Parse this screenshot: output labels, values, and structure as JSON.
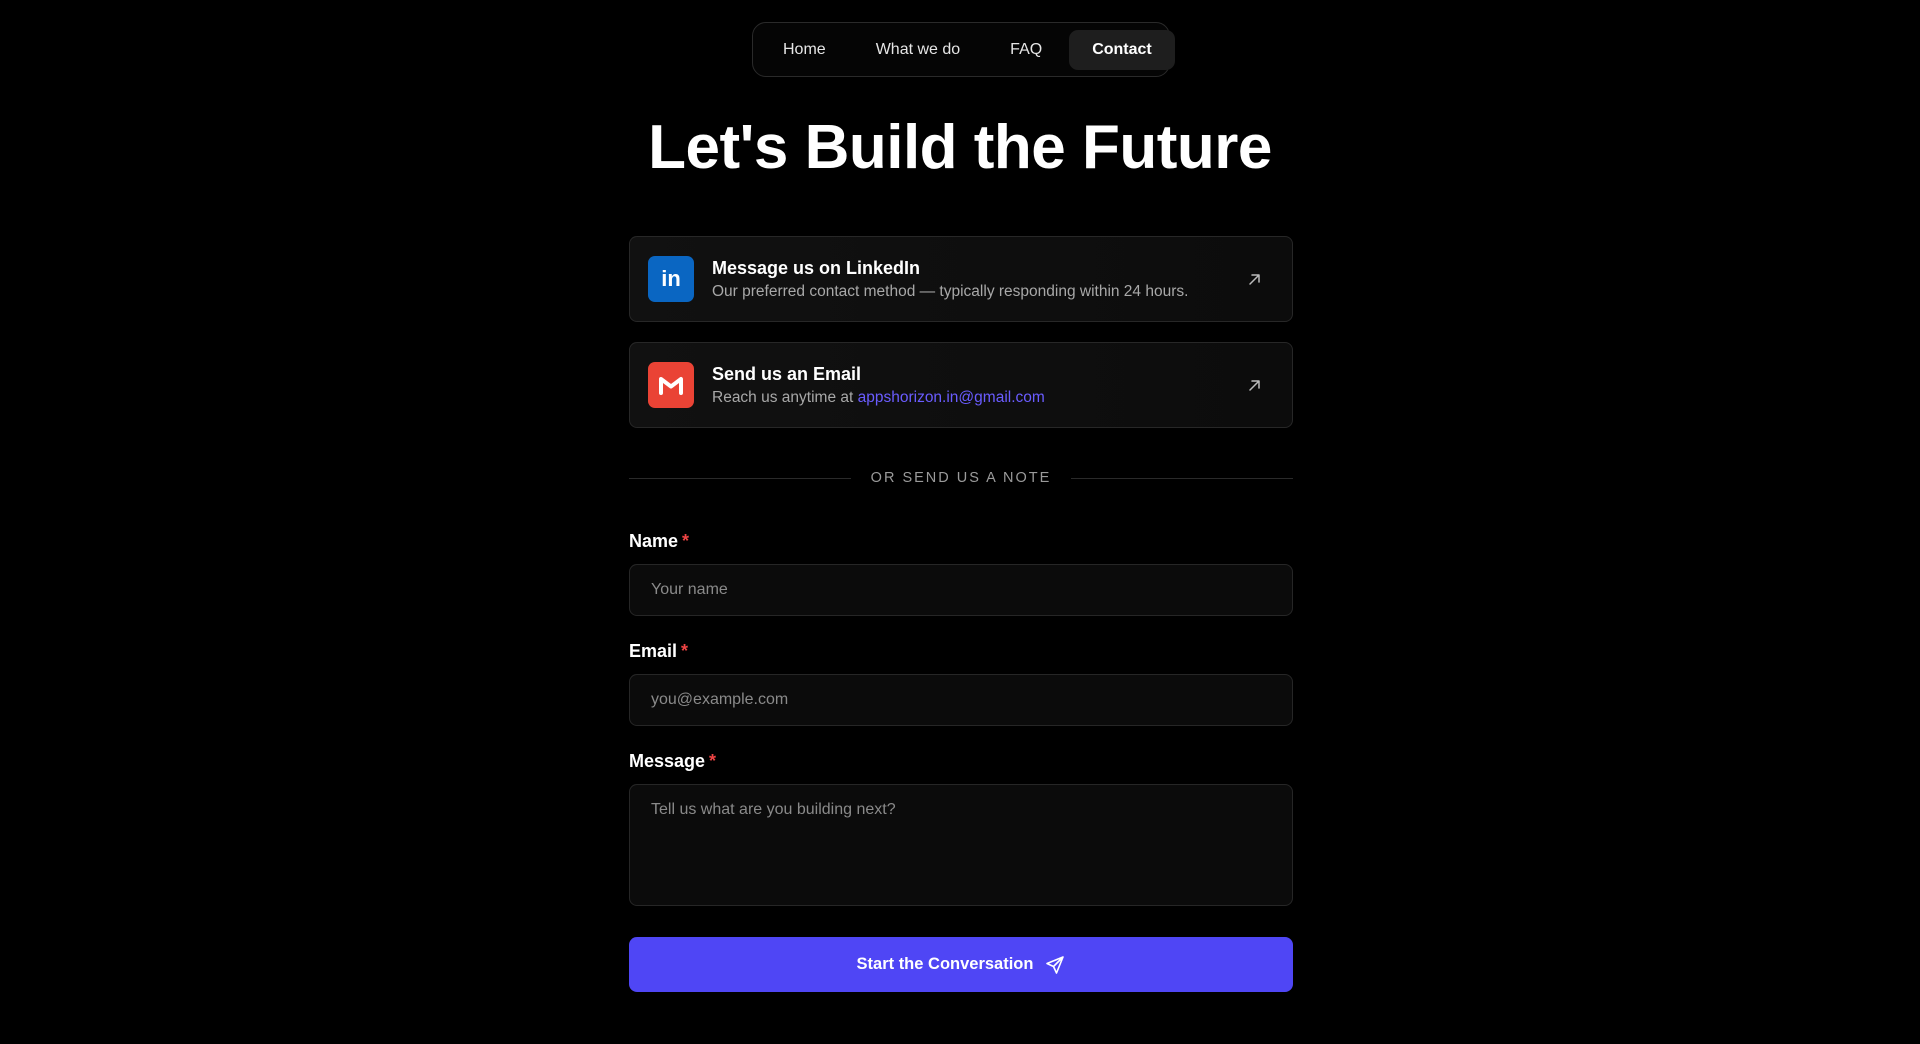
{
  "nav": {
    "items": [
      {
        "label": "Home",
        "active": false
      },
      {
        "label": "What we do",
        "active": false
      },
      {
        "label": "FAQ",
        "active": false
      },
      {
        "label": "Contact",
        "active": true
      }
    ]
  },
  "hero": {
    "title": "Let's Build the Future"
  },
  "contact_cards": {
    "linkedin": {
      "icon": "linkedin-icon",
      "icon_text": "in",
      "title": "Message us on LinkedIn",
      "description": "Our preferred contact method — typically responding within 24 hours."
    },
    "email": {
      "icon": "gmail-icon",
      "title": "Send us an Email",
      "description_prefix": "Reach us anytime at",
      "address": "appshorizon.in@gmail.com"
    }
  },
  "divider": {
    "label": "OR SEND US A NOTE"
  },
  "form": {
    "required_marker": "*",
    "name": {
      "label": "Name",
      "placeholder": "Your name",
      "value": ""
    },
    "email": {
      "label": "Email",
      "placeholder": "you@example.com",
      "value": ""
    },
    "message": {
      "label": "Message",
      "placeholder": "Tell us what are you building next?",
      "value": ""
    },
    "submit_label": "Start the Conversation"
  },
  "colors": {
    "accent": "#4f46f5",
    "linkedin": "#0a66c2",
    "gmail": "#ea4335",
    "required": "#ef4444",
    "link": "#6a5cff"
  }
}
